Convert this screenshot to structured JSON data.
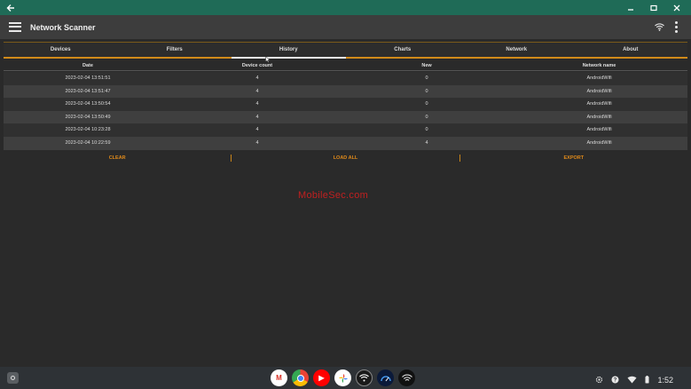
{
  "window": {
    "title": "",
    "back_icon": "back-arrow-icon"
  },
  "appbar": {
    "title": "Network Scanner"
  },
  "tabs": [
    {
      "label": "Devices"
    },
    {
      "label": "Filters"
    },
    {
      "label": "History"
    },
    {
      "label": "Charts"
    },
    {
      "label": "Network"
    },
    {
      "label": "About"
    }
  ],
  "table": {
    "headers": [
      "Date",
      "Device count",
      "New",
      "Network name"
    ],
    "rows": [
      {
        "date": "2023-02-04 13:51:51",
        "count": "4",
        "new": "0",
        "network": "AndroidWifi"
      },
      {
        "date": "2023-02-04 13:51:47",
        "count": "4",
        "new": "0",
        "network": "AndroidWifi"
      },
      {
        "date": "2023-02-04 13:50:54",
        "count": "4",
        "new": "0",
        "network": "AndroidWifi"
      },
      {
        "date": "2023-02-04 13:50:49",
        "count": "4",
        "new": "0",
        "network": "AndroidWifi"
      },
      {
        "date": "2023-02-04 10:23:28",
        "count": "4",
        "new": "0",
        "network": "AndroidWifi"
      },
      {
        "date": "2023-02-04 10:22:59",
        "count": "4",
        "new": "4",
        "network": "AndroidWifi"
      }
    ]
  },
  "actions": {
    "clear": "CLEAR",
    "load_all": "LOAD ALL",
    "export": "EXPORT"
  },
  "watermark": "MobileSec.com",
  "taskbar": {
    "clock": "1:52"
  },
  "colors": {
    "titlebar": "#1f6b57",
    "accent": "#e08a1a",
    "background": "#2a2a2a"
  }
}
